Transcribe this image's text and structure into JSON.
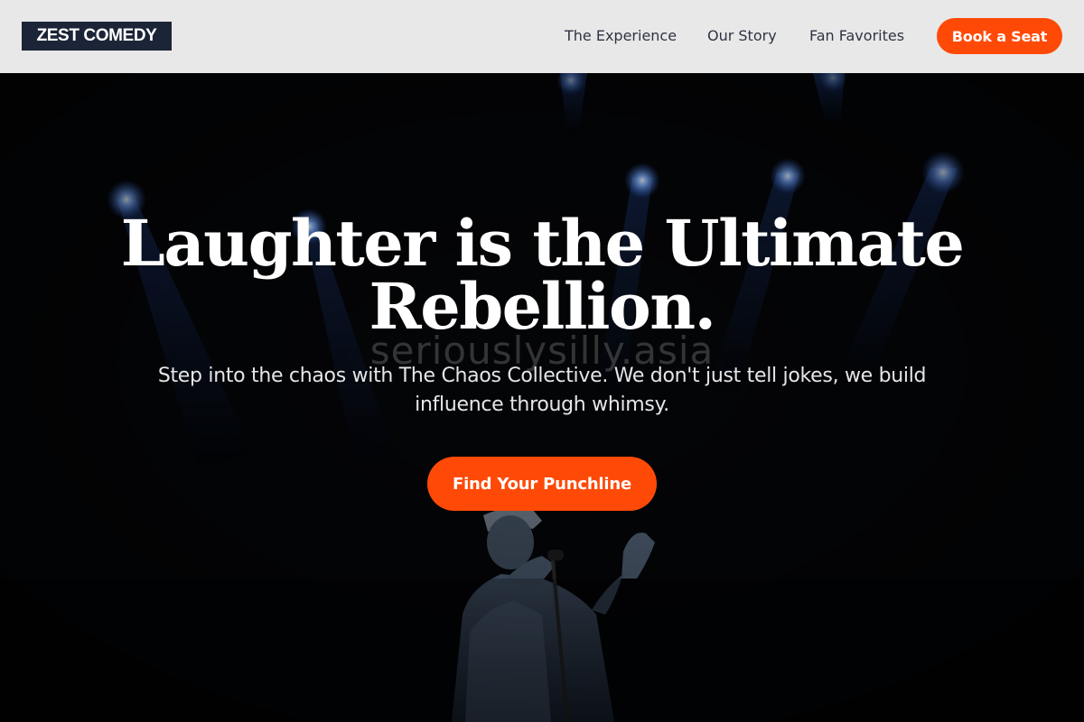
{
  "header": {
    "logo": "ZEST COMEDY",
    "nav": [
      {
        "label": "The Experience"
      },
      {
        "label": "Our Story"
      },
      {
        "label": "Fan Favorites"
      }
    ],
    "book_label": "Book a Seat"
  },
  "hero": {
    "title_line1": "Laughter is the Ultimate",
    "title_line2": "Rebellion.",
    "watermark": "seriouslysilly.asia",
    "subtitle": "Step into the chaos with The Chaos Collective. We don't just tell jokes, we build influence through whimsy.",
    "cta_label": "Find Your Punchline",
    "background_image": "comedian-on-stage-with-blue-spotlights"
  },
  "colors": {
    "accent": "#fe4a06",
    "logo_bg": "#1c2537",
    "header_bg": "#e8e8e9",
    "hero_bg": "#050608",
    "spotlight": "#4a8cff"
  }
}
